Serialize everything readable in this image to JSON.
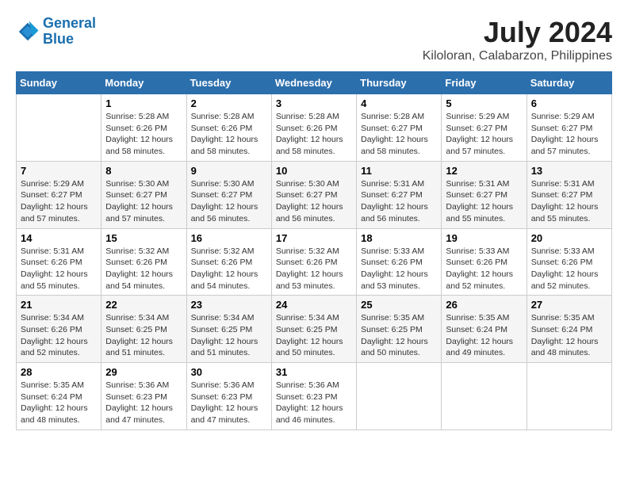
{
  "header": {
    "logo_line1": "General",
    "logo_line2": "Blue",
    "title": "July 2024",
    "subtitle": "Kiloloran, Calabarzon, Philippines"
  },
  "weekdays": [
    "Sunday",
    "Monday",
    "Tuesday",
    "Wednesday",
    "Thursday",
    "Friday",
    "Saturday"
  ],
  "weeks": [
    [
      {
        "day": "",
        "info": ""
      },
      {
        "day": "1",
        "info": "Sunrise: 5:28 AM\nSunset: 6:26 PM\nDaylight: 12 hours\nand 58 minutes."
      },
      {
        "day": "2",
        "info": "Sunrise: 5:28 AM\nSunset: 6:26 PM\nDaylight: 12 hours\nand 58 minutes."
      },
      {
        "day": "3",
        "info": "Sunrise: 5:28 AM\nSunset: 6:26 PM\nDaylight: 12 hours\nand 58 minutes."
      },
      {
        "day": "4",
        "info": "Sunrise: 5:28 AM\nSunset: 6:27 PM\nDaylight: 12 hours\nand 58 minutes."
      },
      {
        "day": "5",
        "info": "Sunrise: 5:29 AM\nSunset: 6:27 PM\nDaylight: 12 hours\nand 57 minutes."
      },
      {
        "day": "6",
        "info": "Sunrise: 5:29 AM\nSunset: 6:27 PM\nDaylight: 12 hours\nand 57 minutes."
      }
    ],
    [
      {
        "day": "7",
        "info": "Sunrise: 5:29 AM\nSunset: 6:27 PM\nDaylight: 12 hours\nand 57 minutes."
      },
      {
        "day": "8",
        "info": "Sunrise: 5:30 AM\nSunset: 6:27 PM\nDaylight: 12 hours\nand 57 minutes."
      },
      {
        "day": "9",
        "info": "Sunrise: 5:30 AM\nSunset: 6:27 PM\nDaylight: 12 hours\nand 56 minutes."
      },
      {
        "day": "10",
        "info": "Sunrise: 5:30 AM\nSunset: 6:27 PM\nDaylight: 12 hours\nand 56 minutes."
      },
      {
        "day": "11",
        "info": "Sunrise: 5:31 AM\nSunset: 6:27 PM\nDaylight: 12 hours\nand 56 minutes."
      },
      {
        "day": "12",
        "info": "Sunrise: 5:31 AM\nSunset: 6:27 PM\nDaylight: 12 hours\nand 55 minutes."
      },
      {
        "day": "13",
        "info": "Sunrise: 5:31 AM\nSunset: 6:27 PM\nDaylight: 12 hours\nand 55 minutes."
      }
    ],
    [
      {
        "day": "14",
        "info": "Sunrise: 5:31 AM\nSunset: 6:26 PM\nDaylight: 12 hours\nand 55 minutes."
      },
      {
        "day": "15",
        "info": "Sunrise: 5:32 AM\nSunset: 6:26 PM\nDaylight: 12 hours\nand 54 minutes."
      },
      {
        "day": "16",
        "info": "Sunrise: 5:32 AM\nSunset: 6:26 PM\nDaylight: 12 hours\nand 54 minutes."
      },
      {
        "day": "17",
        "info": "Sunrise: 5:32 AM\nSunset: 6:26 PM\nDaylight: 12 hours\nand 53 minutes."
      },
      {
        "day": "18",
        "info": "Sunrise: 5:33 AM\nSunset: 6:26 PM\nDaylight: 12 hours\nand 53 minutes."
      },
      {
        "day": "19",
        "info": "Sunrise: 5:33 AM\nSunset: 6:26 PM\nDaylight: 12 hours\nand 52 minutes."
      },
      {
        "day": "20",
        "info": "Sunrise: 5:33 AM\nSunset: 6:26 PM\nDaylight: 12 hours\nand 52 minutes."
      }
    ],
    [
      {
        "day": "21",
        "info": "Sunrise: 5:34 AM\nSunset: 6:26 PM\nDaylight: 12 hours\nand 52 minutes."
      },
      {
        "day": "22",
        "info": "Sunrise: 5:34 AM\nSunset: 6:25 PM\nDaylight: 12 hours\nand 51 minutes."
      },
      {
        "day": "23",
        "info": "Sunrise: 5:34 AM\nSunset: 6:25 PM\nDaylight: 12 hours\nand 51 minutes."
      },
      {
        "day": "24",
        "info": "Sunrise: 5:34 AM\nSunset: 6:25 PM\nDaylight: 12 hours\nand 50 minutes."
      },
      {
        "day": "25",
        "info": "Sunrise: 5:35 AM\nSunset: 6:25 PM\nDaylight: 12 hours\nand 50 minutes."
      },
      {
        "day": "26",
        "info": "Sunrise: 5:35 AM\nSunset: 6:24 PM\nDaylight: 12 hours\nand 49 minutes."
      },
      {
        "day": "27",
        "info": "Sunrise: 5:35 AM\nSunset: 6:24 PM\nDaylight: 12 hours\nand 48 minutes."
      }
    ],
    [
      {
        "day": "28",
        "info": "Sunrise: 5:35 AM\nSunset: 6:24 PM\nDaylight: 12 hours\nand 48 minutes."
      },
      {
        "day": "29",
        "info": "Sunrise: 5:36 AM\nSunset: 6:23 PM\nDaylight: 12 hours\nand 47 minutes."
      },
      {
        "day": "30",
        "info": "Sunrise: 5:36 AM\nSunset: 6:23 PM\nDaylight: 12 hours\nand 47 minutes."
      },
      {
        "day": "31",
        "info": "Sunrise: 5:36 AM\nSunset: 6:23 PM\nDaylight: 12 hours\nand 46 minutes."
      },
      {
        "day": "",
        "info": ""
      },
      {
        "day": "",
        "info": ""
      },
      {
        "day": "",
        "info": ""
      }
    ]
  ]
}
